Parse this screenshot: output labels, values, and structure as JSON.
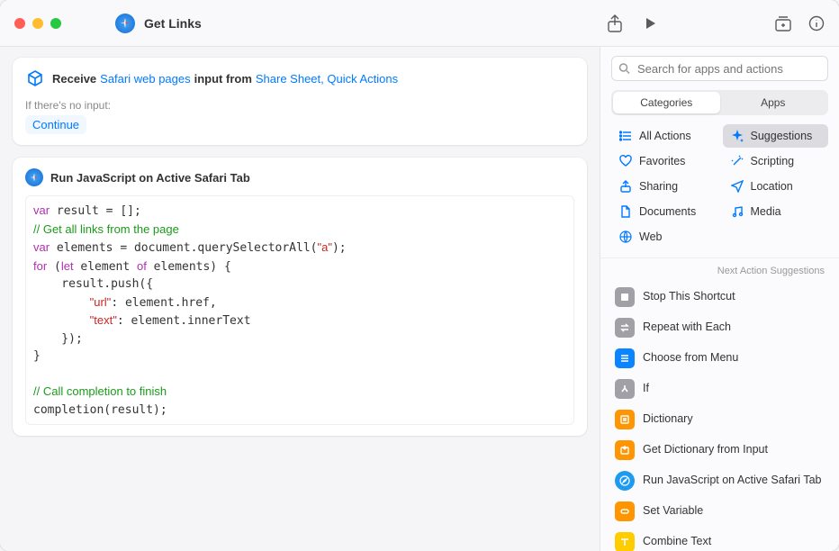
{
  "window": {
    "title": "Get Links"
  },
  "receive": {
    "label_receive": "Receive",
    "input_type": "Safari web pages",
    "label_from": "input from",
    "sources": "Share Sheet, Quick Actions",
    "no_input_label": "If there's no input:",
    "no_input_action": "Continue"
  },
  "action": {
    "title": "Run JavaScript on Active Safari Tab",
    "code_lines": [
      {
        "t": "kw",
        "s": "var"
      },
      {
        "t": "n",
        "s": " result = [];\n"
      },
      {
        "t": "com",
        "s": "// Get all links from the page\n"
      },
      {
        "t": "kw",
        "s": "var"
      },
      {
        "t": "n",
        "s": " elements = document.querySelectorAll("
      },
      {
        "t": "str",
        "s": "\"a\""
      },
      {
        "t": "n",
        "s": ");\n"
      },
      {
        "t": "kw",
        "s": "for"
      },
      {
        "t": "n",
        "s": " ("
      },
      {
        "t": "kw",
        "s": "let"
      },
      {
        "t": "n",
        "s": " element "
      },
      {
        "t": "kw",
        "s": "of"
      },
      {
        "t": "n",
        "s": " elements) {\n    result.push({\n        "
      },
      {
        "t": "str",
        "s": "\"url\""
      },
      {
        "t": "n",
        "s": ": element.href,\n        "
      },
      {
        "t": "str",
        "s": "\"text\""
      },
      {
        "t": "n",
        "s": ": element.innerText\n    });\n}\n\n"
      },
      {
        "t": "com",
        "s": "// Call completion to finish\n"
      },
      {
        "t": "n",
        "s": "completion(result);"
      }
    ]
  },
  "sidebar": {
    "search_placeholder": "Search for apps and actions",
    "seg": {
      "categories": "Categories",
      "apps": "Apps",
      "active": "categories"
    },
    "categories": [
      {
        "name": "All Actions",
        "icon": "list",
        "selected": false
      },
      {
        "name": "Suggestions",
        "icon": "sparkle",
        "selected": true
      },
      {
        "name": "Favorites",
        "icon": "heart",
        "selected": false
      },
      {
        "name": "Scripting",
        "icon": "wand",
        "selected": false
      },
      {
        "name": "Sharing",
        "icon": "share",
        "selected": false
      },
      {
        "name": "Location",
        "icon": "loc",
        "selected": false
      },
      {
        "name": "Documents",
        "icon": "doc",
        "selected": false
      },
      {
        "name": "Media",
        "icon": "music",
        "selected": false
      },
      {
        "name": "Web",
        "icon": "globe",
        "selected": false
      }
    ],
    "suggestions_header": "Next Action Suggestions",
    "suggestions": [
      {
        "name": "Stop This Shortcut",
        "color": "#a0a0a6",
        "icon": "stop"
      },
      {
        "name": "Repeat with Each",
        "color": "#a0a0a6",
        "icon": "repeat"
      },
      {
        "name": "Choose from Menu",
        "color": "#0a84ff",
        "icon": "menu"
      },
      {
        "name": "If",
        "color": "#a0a0a6",
        "icon": "branch"
      },
      {
        "name": "Dictionary",
        "color": "#ff9500",
        "icon": "dict"
      },
      {
        "name": "Get Dictionary from Input",
        "color": "#ff9500",
        "icon": "dictin"
      },
      {
        "name": "Run JavaScript on Active Safari Tab",
        "color": "#1e9bf0",
        "icon": "safari"
      },
      {
        "name": "Set Variable",
        "color": "#ff9500",
        "icon": "var"
      },
      {
        "name": "Combine Text",
        "color": "#ffcc00",
        "icon": "text"
      }
    ]
  }
}
